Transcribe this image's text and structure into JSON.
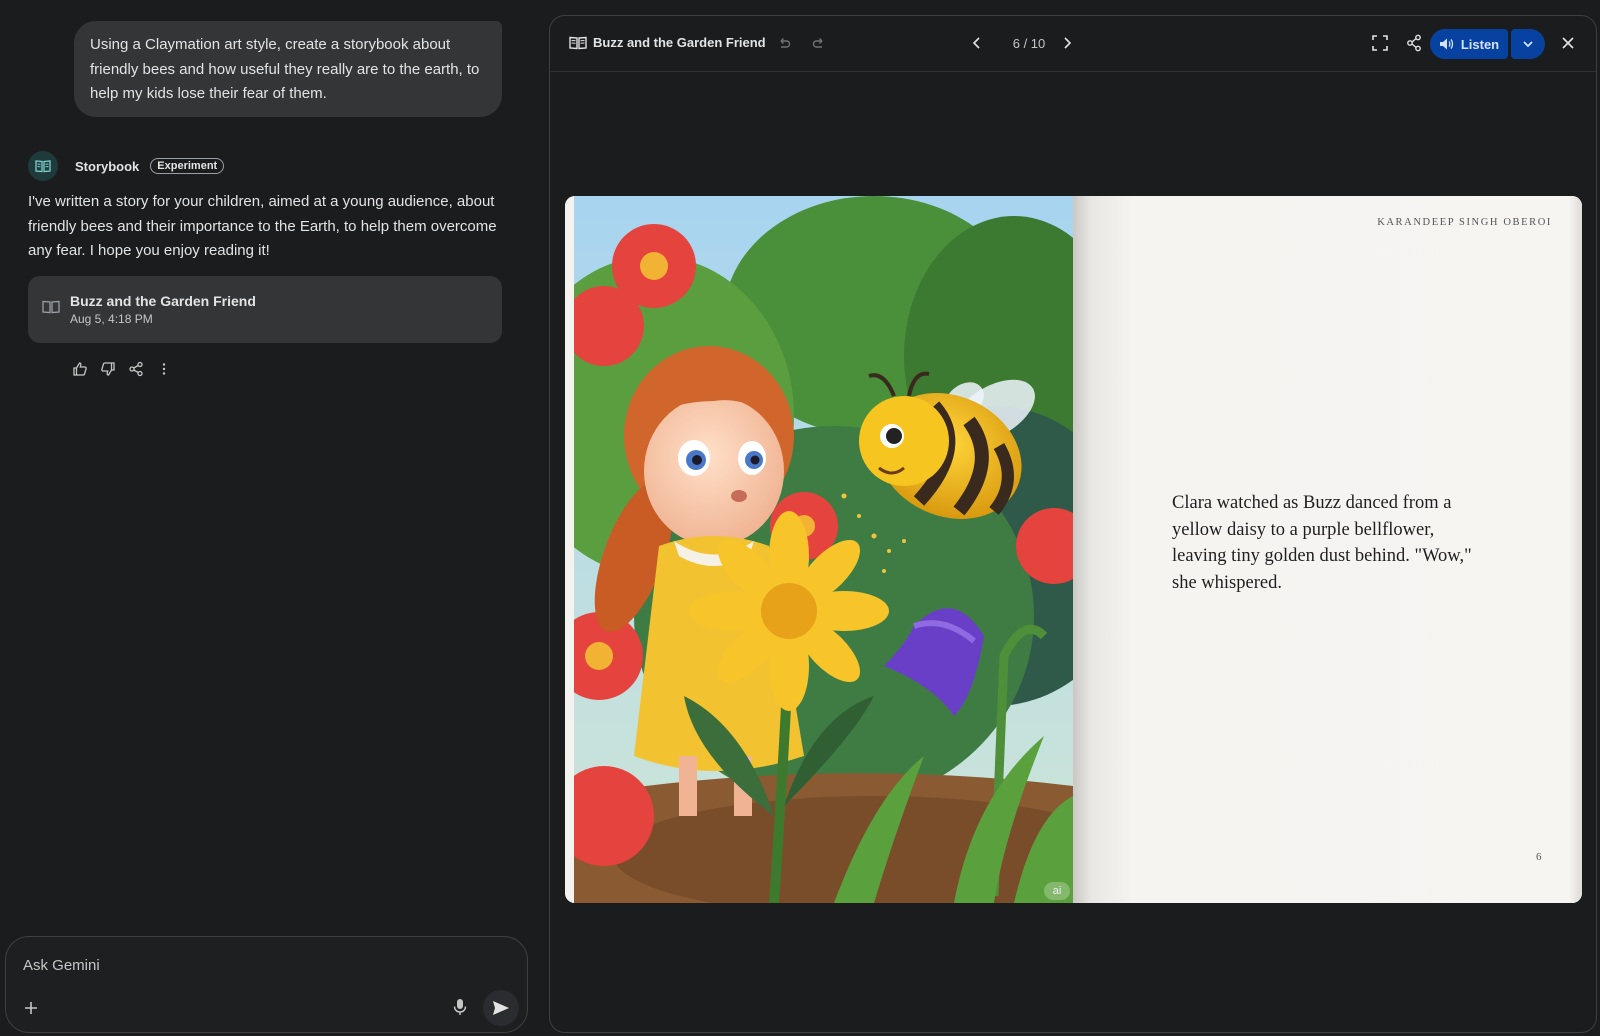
{
  "chat": {
    "user_prompt": "Using a Claymation art style, create a storybook about friendly bees and how useful they really are to the earth, to help my kids lose their fear of them.",
    "agent_name": "Storybook",
    "agent_badge": "Experiment",
    "agent_message": "I've written a story for your children, aimed at a young audience, about friendly bees and their importance to the Earth, to help them overcome any fear. I hope you enjoy reading it!",
    "story_card": {
      "title": "Buzz and the Garden Friend",
      "date": "Aug 5, 4:18 PM"
    },
    "feedback_icons": [
      "thumbs-up-icon",
      "thumbs-down-icon",
      "share-icon",
      "more-vert-icon"
    ],
    "input": {
      "placeholder": "Ask Gemini"
    }
  },
  "storybook": {
    "title": "Buzz and the Garden Friend",
    "page_indicator": "6 / 10",
    "current_page": 6,
    "total_pages": 10,
    "listen_label": "Listen",
    "author": "KARANDEEP SINGH OBEROI",
    "page_text": "Clara watched as Buzz danced from a yellow daisy to a purple bellflower, leaving tiny golden dust behind. \"Wow,\" she whispered.",
    "page_number": "6",
    "ai_badge": "ai",
    "colors": {
      "accent_button": "#0842a0",
      "page_bg": "#f5f4f1"
    }
  }
}
